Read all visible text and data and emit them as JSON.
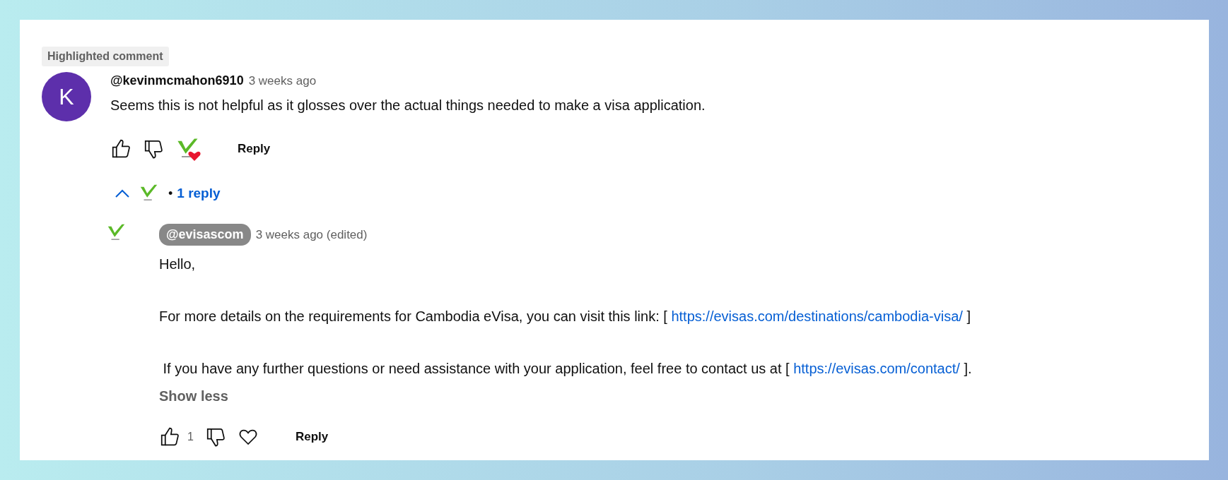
{
  "badge": "Highlighted comment",
  "comment": {
    "avatar_letter": "K",
    "author": "@kevinmcmahon6910",
    "author_is_creator": false,
    "time": "3 weeks ago",
    "text": "Seems this is not helpful as it glosses over the actual things needed to make a visa application.",
    "creator_hearted": true,
    "reply_button": "Reply"
  },
  "replies_toggle": {
    "expanded": true,
    "bullet": "•",
    "label": "1 reply"
  },
  "replies": [
    {
      "author": "@evisascom",
      "author_is_creator": true,
      "time": "3 weeks ago (edited)",
      "paragraphs": [
        {
          "parts": [
            {
              "kind": "text",
              "text": "Hello,"
            }
          ]
        },
        {
          "parts": [
            {
              "kind": "text",
              "text": "For more details on the requirements for Cambodia eVisa, you can visit this link: [ "
            },
            {
              "kind": "link",
              "text": "https://evisas.com/destinations/cambodia-visa/"
            },
            {
              "kind": "text",
              "text": " ]"
            }
          ]
        },
        {
          "parts": [
            {
              "kind": "text",
              "text": " If you have any further questions or need assistance with your application, feel free to contact us at [ "
            },
            {
              "kind": "link",
              "text": "https://evisas.com/contact/"
            },
            {
              "kind": "text",
              "text": " ]."
            }
          ]
        }
      ],
      "show_less": "Show less",
      "likes": "1",
      "creator_hearted": false,
      "reply_button": "Reply"
    }
  ]
}
